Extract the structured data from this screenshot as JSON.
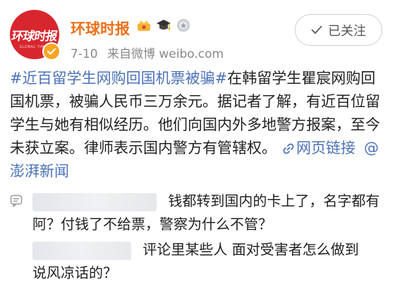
{
  "header": {
    "account_name": "环球时报",
    "avatar_mark": "环球时报",
    "avatar_sub": "GLOBAL TIMES",
    "date": "7-10",
    "source": "来自微博 weibo.com",
    "follow_label": "已关注",
    "badges": [
      "crown-icon",
      "graduation-cap-icon",
      "medal-icon"
    ]
  },
  "post": {
    "topic": "#近百留学生网购回国机票被骗#",
    "body": "在韩留学生瞿宸网购回国机票，被骗人民币三万余元。据记者了解，有近百位留学生与她有相似经历。他们向国内外多地警方报案，至今未获立案。律师表示国内警方有管辖权。",
    "link_label": "网页链接",
    "mention": "@澎湃新闻"
  },
  "comments": [
    {
      "text_line1": "钱都转到国内的卡上了，名字都有",
      "text_line2": "阿？付钱了不给票，警察为什么不管？"
    },
    {
      "text_line1": "评论里某些人  面对受害者怎么做到",
      "text_line2": "说风凉话的？"
    }
  ],
  "colors": {
    "accent": "#ef7019",
    "link": "#4c72b8",
    "brand": "#d8262f"
  }
}
